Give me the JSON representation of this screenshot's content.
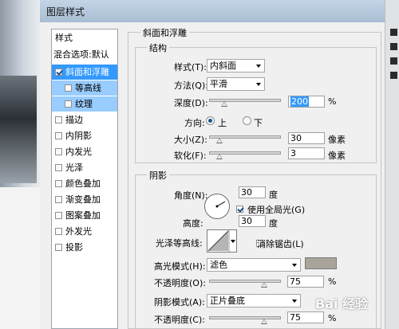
{
  "dialog": {
    "title": "图层样式"
  },
  "sidebar": {
    "header": "样式",
    "blend": "混合选项:默认",
    "items": [
      {
        "label": "斜面和浮雕",
        "checked": true,
        "selected": true
      },
      {
        "label": "等高线",
        "checked": false,
        "sub": true
      },
      {
        "label": "纹理",
        "checked": false,
        "sub": true
      },
      {
        "label": "描边",
        "checked": false
      },
      {
        "label": "内阴影",
        "checked": false
      },
      {
        "label": "内发光",
        "checked": false
      },
      {
        "label": "光泽",
        "checked": false
      },
      {
        "label": "颜色叠加",
        "checked": false
      },
      {
        "label": "渐变叠加",
        "checked": false
      },
      {
        "label": "图案叠加",
        "checked": false
      },
      {
        "label": "外发光",
        "checked": false
      },
      {
        "label": "投影",
        "checked": false
      }
    ]
  },
  "bevel": {
    "title": "斜面和浮雕",
    "structure": {
      "title": "结构",
      "style_label": "样式(T):",
      "style_value": "内斜面",
      "technique_label": "方法(Q):",
      "technique_value": "平滑",
      "depth_label": "深度(D):",
      "depth_value": "200",
      "depth_unit": "%",
      "direction_label": "方向:",
      "dir_up": "上",
      "dir_down": "下",
      "size_label": "大小(Z):",
      "size_value": "30",
      "size_unit": "像素",
      "soften_label": "软化(F):",
      "soften_value": "3",
      "soften_unit": "像素"
    },
    "shading": {
      "title": "阴影",
      "angle_label": "角度(N):",
      "angle_value": "30",
      "angle_unit": "度",
      "global_light_label": "使用全局光(G)",
      "altitude_label": "高度:",
      "altitude_value": "30",
      "altitude_unit": "度",
      "gloss_label": "光泽等高线:",
      "antialias_label": "消除锯齿(L)",
      "highlight_mode_label": "高光模式(H):",
      "highlight_mode_value": "滤色",
      "highlight_color": "#a9a49a",
      "opacity1_label": "不透明度(O):",
      "opacity1_value": "75",
      "opacity1_unit": "%",
      "shadow_mode_label": "阴影模式(A):",
      "shadow_mode_value": "正片叠底",
      "opacity2_label": "不透明度(C):",
      "opacity2_value": "75",
      "opacity2_unit": "%"
    }
  },
  "watermark": "Bai 经验"
}
